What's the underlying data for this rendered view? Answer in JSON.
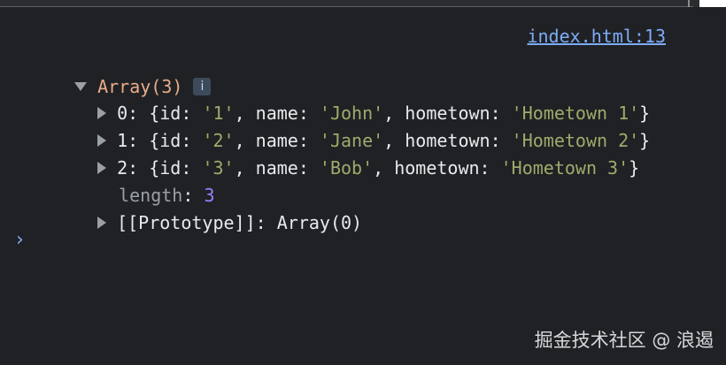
{
  "console": {
    "source_link": "index.html:13",
    "array_title": "Array(3)",
    "info_badge": "i",
    "entries": [
      {
        "index": "0",
        "id": "'1'",
        "name": "'John'",
        "hometown": "'Hometown 1'"
      },
      {
        "index": "1",
        "id": "'2'",
        "name": "'Jane'",
        "hometown": "'Hometown 2'"
      },
      {
        "index": "2",
        "id": "'3'",
        "name": "'Bob'",
        "hometown": "'Hometown 3'"
      }
    ],
    "length_label": "length",
    "length_value": "3",
    "prototype_label": "[[Prototype]]",
    "prototype_value": "Array(0)",
    "prompt_glyph": "›"
  },
  "watermark": "掘金技术社区 @ 浪遏",
  "colors": {
    "background": "#202124",
    "link": "#7cacf8",
    "string": "#9dab6c",
    "number": "#9980ff",
    "object_title": "#e8ac8a"
  },
  "icons": {
    "expand_open": "triangle-down-icon",
    "expand_closed": "triangle-right-icon",
    "info": "info-icon",
    "prompt": "chevron-right-icon"
  }
}
